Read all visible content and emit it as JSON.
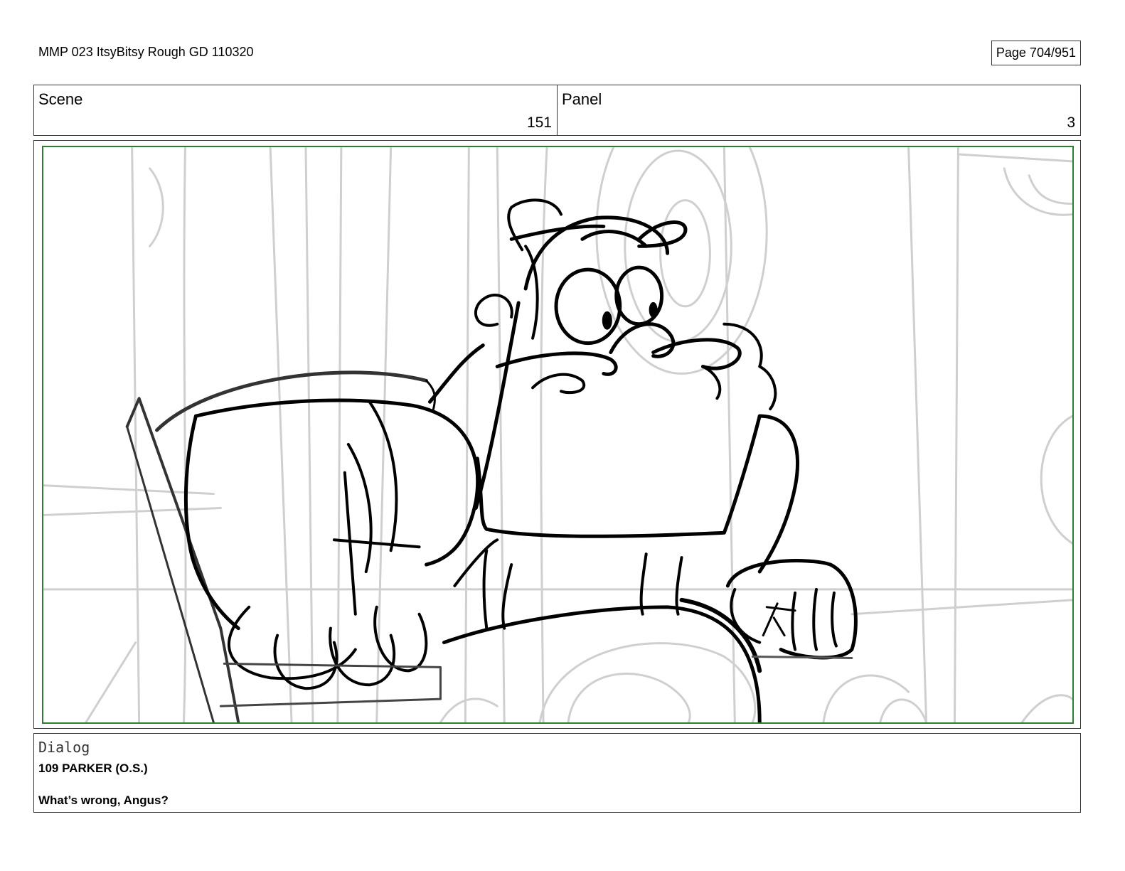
{
  "header": {
    "document_title": "MMP 023 ItsyBitsy Rough GD 110320",
    "page_indicator": "Page 704/951"
  },
  "scene": {
    "label": "Scene",
    "value": "151"
  },
  "panel": {
    "label": "Panel",
    "value": "3"
  },
  "dialog": {
    "label": "Dialog",
    "speaker": "109 PARKER (O.S.)",
    "line": "What’s wrong, Angus?"
  },
  "colors": {
    "safe_area_border": "#2e7d32",
    "background_sketch": "#cfcfcf",
    "foreground_sketch": "#000000"
  }
}
